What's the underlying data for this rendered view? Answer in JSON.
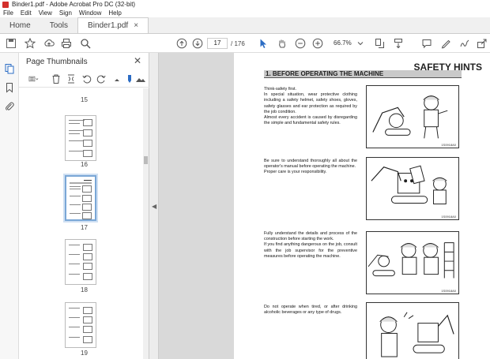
{
  "window": {
    "title": "Binder1.pdf - Adobe Acrobat Pro DC (32-bit)"
  },
  "menu": [
    "File",
    "Edit",
    "View",
    "Sign",
    "Window",
    "Help"
  ],
  "tabs": {
    "home": "Home",
    "tools": "Tools",
    "document": "Binder1.pdf",
    "close": "×"
  },
  "toolbar": {
    "page_current": "17",
    "page_total": "/ 176",
    "zoom": "66.7%"
  },
  "panel": {
    "title": "Page Thumbnails",
    "close": "✕",
    "thumbnails": [
      "15",
      "16",
      "17",
      "18",
      "19"
    ],
    "selected": "17"
  },
  "document": {
    "header": "SAFETY HINTS",
    "section": "1. BEFORE OPERATING THE MACHINE",
    "paragraphs": [
      "Think-safety first.\nIn special situation, wear protective clothing including a safety helmet, safety shoes, gloves, safety glasses and ear protection as required by the job condition.\nAlmost every accident is caused by disregarding the simple and fundamental safety rules.",
      "Be sure to understand thoroughly all about the operator's manual before operating the machine.\nProper care is your responsibility.",
      "Fully understand the details and process of the construction before starting the work.\nIf you find anything dangerous on the job, consult with the job supervisor for the preventive measures before operating the machine.",
      "Do not operate when tired, or after drinking alcoholic beverages or any type of drugs."
    ],
    "figure_codes": [
      "1S0918A0",
      "1S0918A0",
      "1S0918A0"
    ]
  },
  "colors": {
    "accent": "#d3302c",
    "selection": "#7aa7d6",
    "canvas": "#d9d9d9"
  }
}
